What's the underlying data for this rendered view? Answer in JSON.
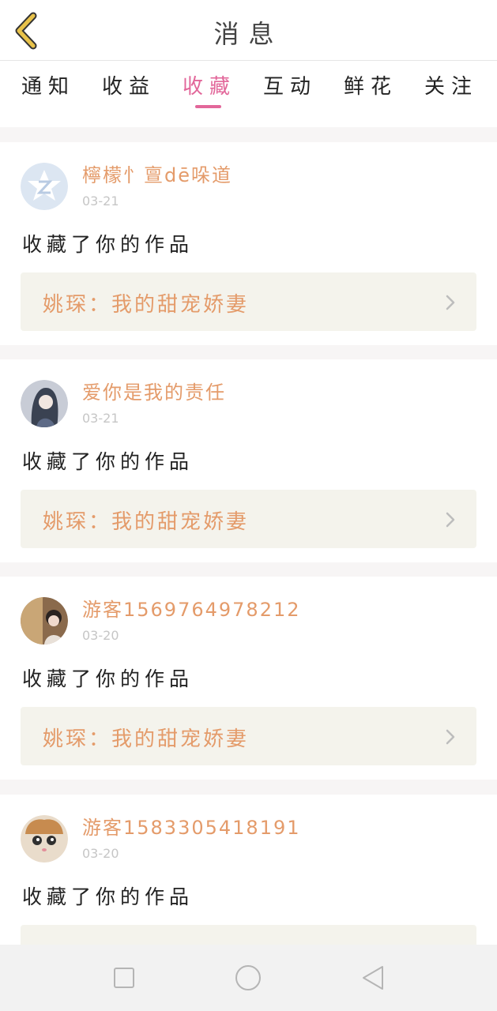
{
  "header": {
    "title": "消息",
    "back_icon": "chevron-left-icon"
  },
  "tabs": [
    {
      "label": "通知",
      "active": false
    },
    {
      "label": "收益",
      "active": false
    },
    {
      "label": "收藏",
      "active": true
    },
    {
      "label": "互动",
      "active": false
    },
    {
      "label": "鲜花",
      "active": false
    },
    {
      "label": "关注",
      "active": false
    }
  ],
  "notifications": [
    {
      "username": "檸檬忄亶dē哚道",
      "date": "03-21",
      "action": "收藏了你的作品",
      "work_title": "姚琛：我的甜宠娇妻"
    },
    {
      "username": "爱你是我的责任",
      "date": "03-21",
      "action": "收藏了你的作品",
      "work_title": "姚琛：我的甜宠娇妻"
    },
    {
      "username": "游客1569764978212",
      "date": "03-20",
      "action": "收藏了你的作品",
      "work_title": "姚琛：我的甜宠娇妻"
    },
    {
      "username": "游客1583305418191",
      "date": "03-20",
      "action": "收藏了你的作品",
      "work_title": ""
    }
  ],
  "colors": {
    "accent": "#e2679a",
    "username": "#e49b6a",
    "back_icon": "#e8c24a"
  },
  "system_nav": {
    "icons": [
      "square-icon",
      "circle-icon",
      "triangle-back-icon"
    ]
  }
}
